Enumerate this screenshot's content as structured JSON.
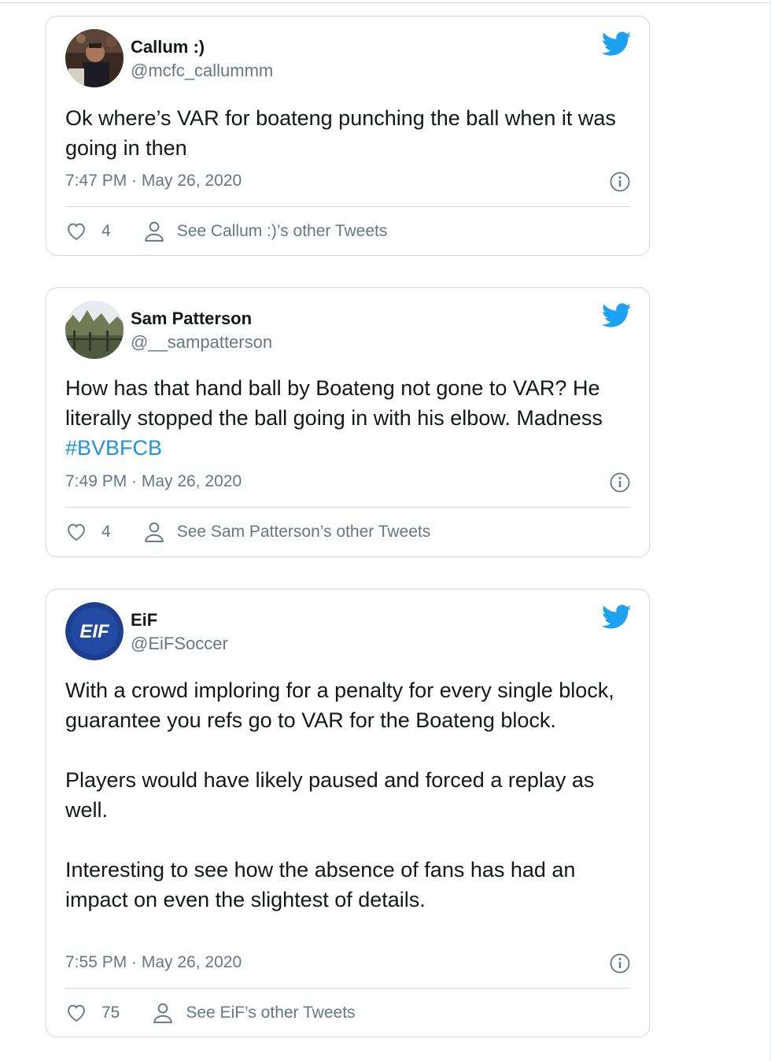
{
  "colors": {
    "brand": "#1da1f2",
    "hashtag": "#1b95e0",
    "secondary_text": "#657786",
    "border": "#cfd9de"
  },
  "tweets": [
    {
      "display_name": "Callum :)",
      "handle": "@mcfc_callummm",
      "paragraphs": [
        "Ok where’s VAR for boateng punching the ball when it was going in then"
      ],
      "hashtag": "",
      "timestamp": "7:47 PM · May 26, 2020",
      "likes": "4",
      "other_tweets_label": "See Callum :)’s other Tweets"
    },
    {
      "display_name": "Sam Patterson",
      "handle": "@__sampatterson",
      "paragraphs": [
        "How has that hand ball by Boateng not gone to VAR? He literally stopped the ball going in with his elbow. Madness "
      ],
      "hashtag": "#BVBFCB",
      "timestamp": "7:49 PM · May 26, 2020",
      "likes": "4",
      "other_tweets_label": "See Sam Patterson’s other Tweets"
    },
    {
      "display_name": "EiF",
      "handle": "@EiFSoccer",
      "avatar_logo_text": "EIF",
      "paragraphs": [
        "With a crowd imploring for a penalty for every single block, guarantee you refs go to VAR for the Boateng block.",
        "Players would have likely paused and forced a replay as well.",
        "Interesting to see how the absence of fans has had an impact on even the slightest of details."
      ],
      "hashtag": "",
      "timestamp": "7:55 PM · May 26, 2020",
      "likes": "75",
      "other_tweets_label": "See EiF’s other Tweets"
    }
  ],
  "icons": {
    "brand": "twitter-bird-icon",
    "info": "info-icon",
    "like": "heart-icon",
    "profile": "person-icon"
  }
}
